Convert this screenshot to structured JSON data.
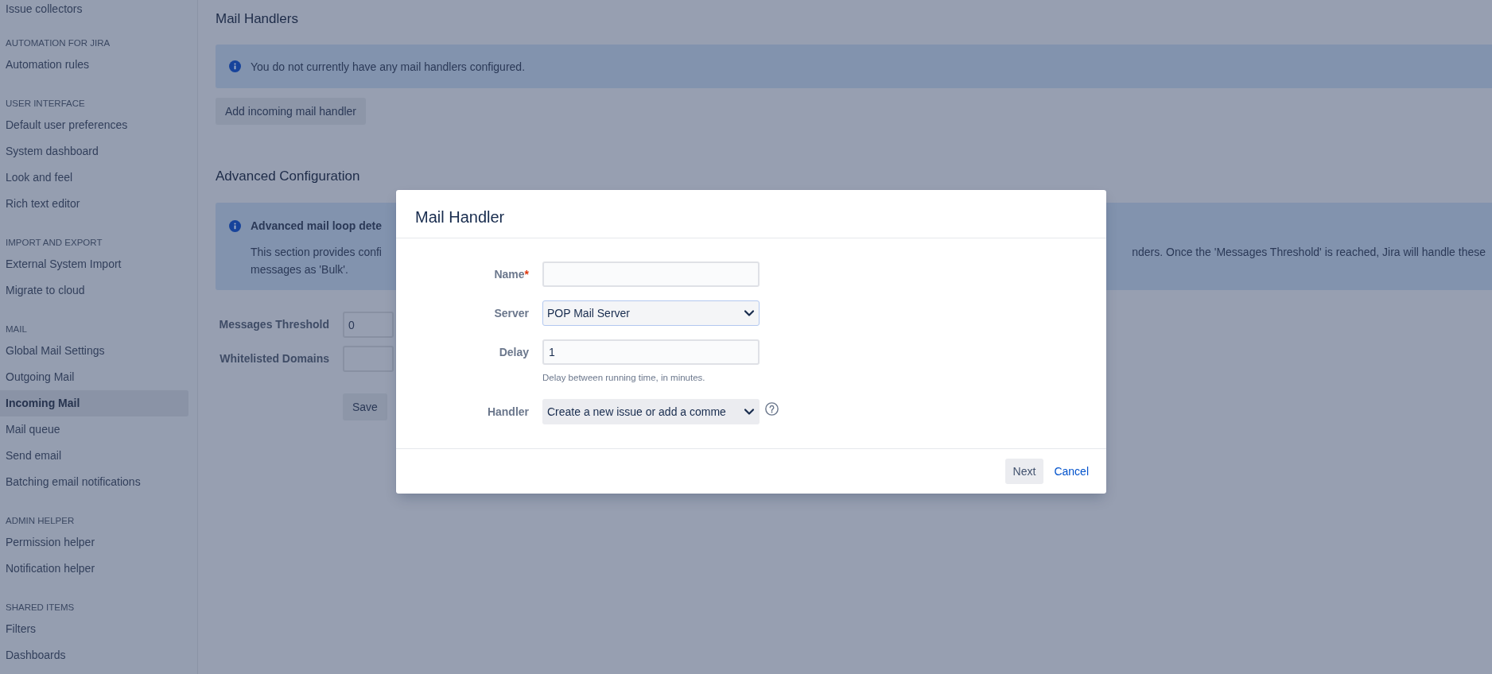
{
  "sidebar": {
    "sections": [
      {
        "items": [
          {
            "label": "Issue collectors",
            "selected": false
          }
        ]
      },
      {
        "header": "AUTOMATION FOR JIRA",
        "items": [
          {
            "label": "Automation rules",
            "selected": false
          }
        ]
      },
      {
        "header": "USER INTERFACE",
        "items": [
          {
            "label": "Default user preferences",
            "selected": false
          },
          {
            "label": "System dashboard",
            "selected": false
          },
          {
            "label": "Look and feel",
            "selected": false
          },
          {
            "label": "Rich text editor",
            "selected": false
          }
        ]
      },
      {
        "header": "IMPORT AND EXPORT",
        "items": [
          {
            "label": "External System Import",
            "selected": false
          },
          {
            "label": "Migrate to cloud",
            "selected": false
          }
        ]
      },
      {
        "header": "MAIL",
        "items": [
          {
            "label": "Global Mail Settings",
            "selected": false
          },
          {
            "label": "Outgoing Mail",
            "selected": false
          },
          {
            "label": "Incoming Mail",
            "selected": true
          },
          {
            "label": "Mail queue",
            "selected": false
          },
          {
            "label": "Send email",
            "selected": false
          },
          {
            "label": "Batching email notifications",
            "selected": false
          }
        ]
      },
      {
        "header": "ADMIN HELPER",
        "items": [
          {
            "label": "Permission helper",
            "selected": false
          },
          {
            "label": "Notification helper",
            "selected": false
          }
        ]
      },
      {
        "header": "SHARED ITEMS",
        "items": [
          {
            "label": "Filters",
            "selected": false
          },
          {
            "label": "Dashboards",
            "selected": false
          }
        ]
      }
    ]
  },
  "mail_handlers": {
    "heading": "Mail Handlers",
    "notice": "You do not currently have any mail handlers configured.",
    "button": "Add incoming mail handler"
  },
  "advanced_configuration": {
    "heading": "Advanced Configuration",
    "notice": {
      "title": "Advanced mail loop dete",
      "line_1_left": "This section provides confi",
      "line_1_right": "nders. Once the 'Messages Threshold' is reached, Jira will handle these",
      "line_2": "messages as 'Bulk'."
    },
    "fields": [
      {
        "label": "Messages Threshold",
        "value": "0"
      },
      {
        "label": "Whitelisted Domains"
      }
    ],
    "button": "Save"
  },
  "dialog": {
    "title": "Mail Handler",
    "fields": [
      {
        "kind": "text",
        "label": "Name",
        "required_mark": "*",
        "focused": false,
        "help": false
      },
      {
        "kind": "select",
        "label": "Server",
        "value": "POP Mail Server",
        "focused": true,
        "help": false
      },
      {
        "kind": "text",
        "label": "Delay",
        "value": "1",
        "hint": "Delay between running time, in minutes.",
        "focused": false,
        "help": false
      },
      {
        "kind": "select",
        "label": "Handler",
        "value": "Create a new issue or add a comme",
        "focused": false,
        "help": true
      }
    ],
    "buttons": [
      {
        "kind": "button",
        "label": "Next"
      },
      {
        "kind": "link",
        "label": "Cancel"
      }
    ]
  }
}
